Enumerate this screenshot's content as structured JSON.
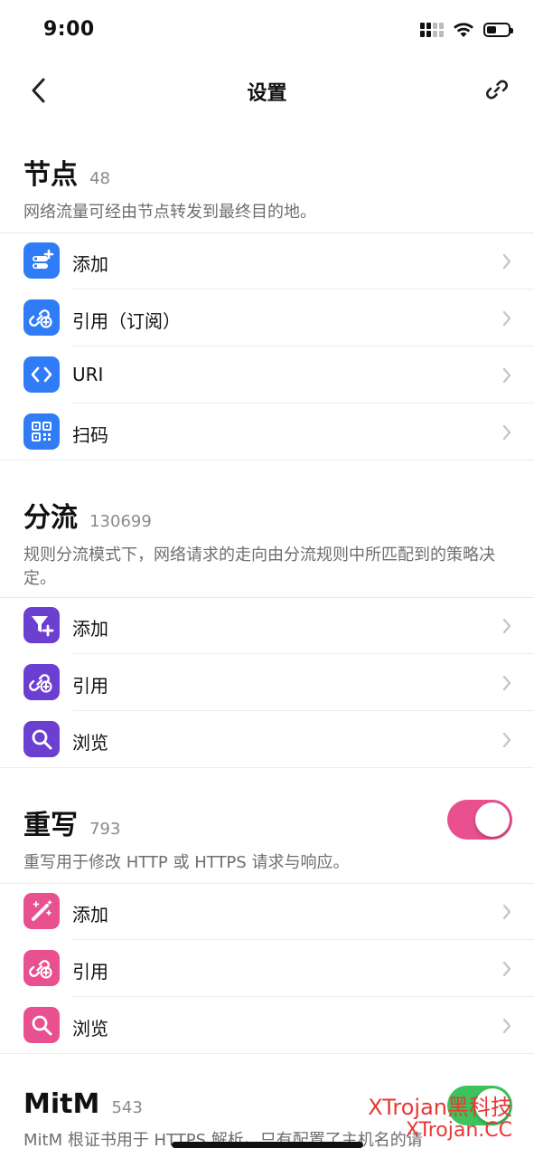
{
  "status_bar": {
    "time": "9:00",
    "battery_level": 0.45
  },
  "nav": {
    "title": "设置",
    "back_icon": "chevron-left-icon",
    "link_icon": "link-icon"
  },
  "nodes": {
    "title": "节点",
    "count": "48",
    "description": "网络流量可经由节点转发到最终目的地。",
    "color": "#2f7cf6",
    "items": [
      {
        "label": "添加",
        "icon": "add-node-icon"
      },
      {
        "label": "引用（订阅）",
        "icon": "link-plus-icon"
      },
      {
        "label": "URI",
        "icon": "code-icon"
      },
      {
        "label": "扫码",
        "icon": "qr-code-icon"
      }
    ]
  },
  "rules": {
    "title": "分流",
    "count": "130699",
    "description": "规则分流模式下，网络请求的走向由分流规则中所匹配到的策略决定。",
    "color": "#6b3fd0",
    "items": [
      {
        "label": "添加",
        "icon": "filter-plus-icon"
      },
      {
        "label": "引用",
        "icon": "link-plus-icon"
      },
      {
        "label": "浏览",
        "icon": "search-icon"
      }
    ]
  },
  "rewrite": {
    "title": "重写",
    "count": "793",
    "description": "重写用于修改 HTTP 或 HTTPS 请求与响应。",
    "color": "#e9508f",
    "enabled": true,
    "items": [
      {
        "label": "添加",
        "icon": "magic-wand-icon"
      },
      {
        "label": "引用",
        "icon": "link-plus-icon"
      },
      {
        "label": "浏览",
        "icon": "search-icon"
      }
    ]
  },
  "mitm": {
    "title": "MitM",
    "count": "543",
    "description": "MitM 根证书用于 HTTPS 解析。只有配置了主机名的请",
    "color": "#3cc35b",
    "enabled": true
  },
  "watermark": {
    "line1": "XTrojan黑科技",
    "line2": "XTrojan.CC"
  }
}
